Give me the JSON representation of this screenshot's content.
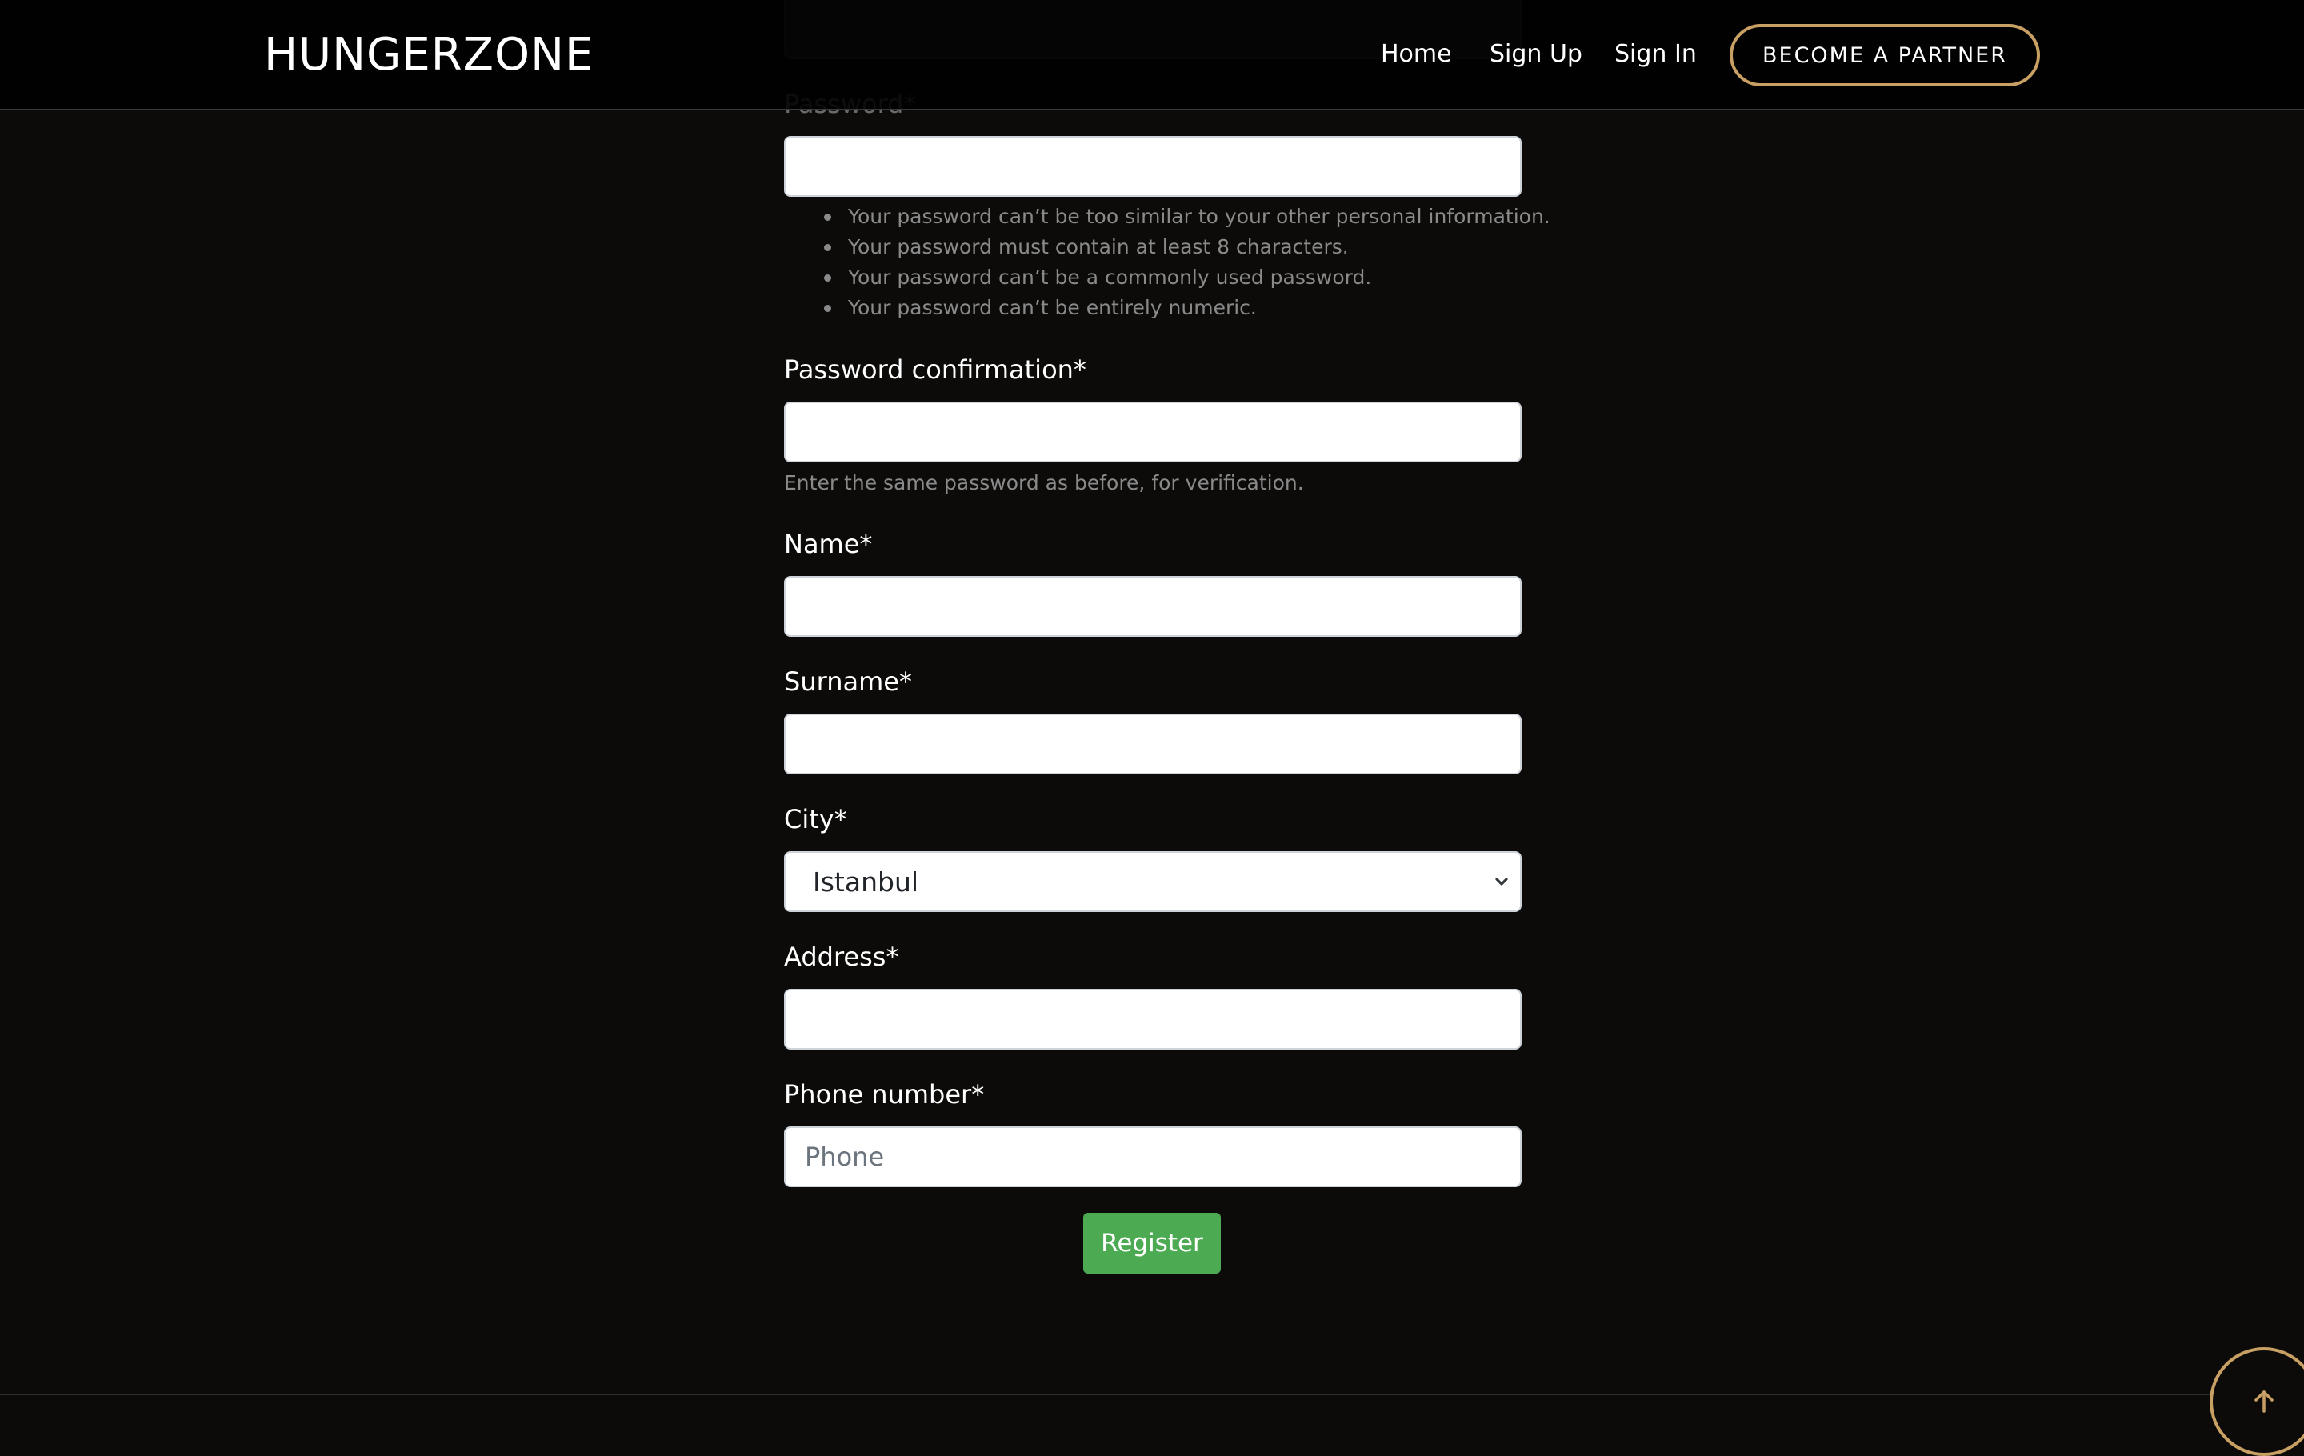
{
  "header": {
    "logo": "HUNGERZONE",
    "nav": {
      "home": "Home",
      "sign_up": "Sign Up",
      "sign_in": "Sign In"
    },
    "partner_button": "BECOME A PARTNER"
  },
  "form": {
    "password": {
      "label": "Password*",
      "value": "",
      "help": [
        "Your password can’t be too similar to your other personal information.",
        "Your password must contain at least 8 characters.",
        "Your password can’t be a commonly used password.",
        "Your password can’t be entirely numeric."
      ]
    },
    "password_confirmation": {
      "label": "Password confirmation*",
      "value": "",
      "help": "Enter the same password as before, for verification."
    },
    "name": {
      "label": "Name*",
      "value": ""
    },
    "surname": {
      "label": "Surname*",
      "value": ""
    },
    "city": {
      "label": "City*",
      "selected": "Istanbul"
    },
    "address": {
      "label": "Address*",
      "value": ""
    },
    "phone": {
      "label": "Phone number*",
      "value": "",
      "placeholder": "Phone"
    },
    "submit_label": "Register"
  },
  "icons": {
    "select_chevron": "chevron-down-icon",
    "scroll_top": "arrow-up-icon"
  },
  "colors": {
    "background": "#0c0b0a",
    "accent_gold": "#c9a063",
    "register_green": "#4caa52"
  }
}
